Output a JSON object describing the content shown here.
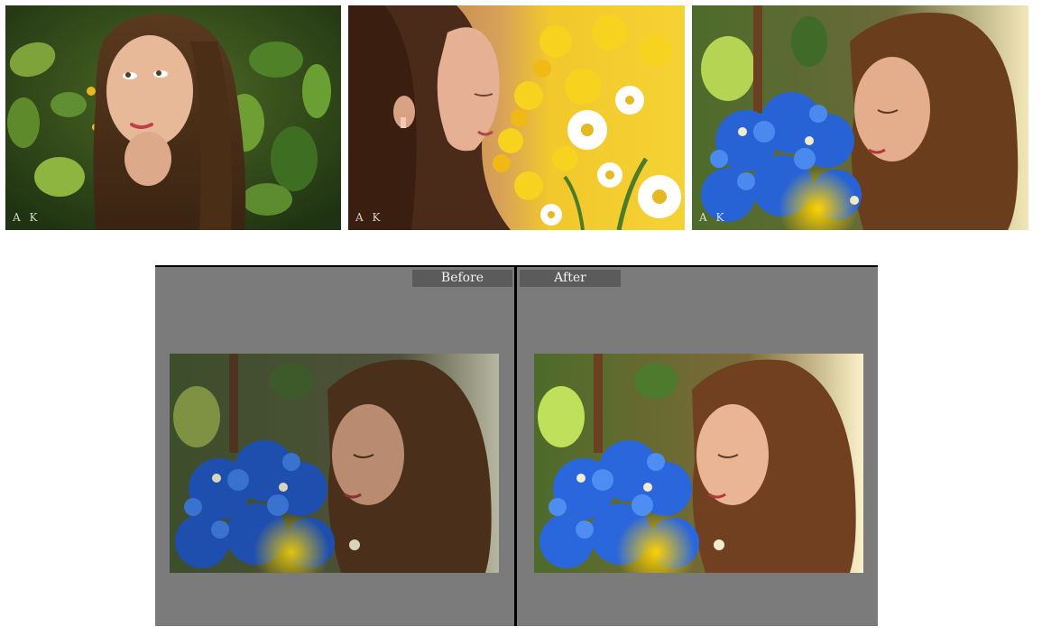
{
  "thumbnails": [
    {
      "name": "portrait-green-leaves",
      "watermark": "A K"
    },
    {
      "name": "portrait-yellow-daisies",
      "watermark": "A K"
    },
    {
      "name": "portrait-blue-hydrangea",
      "watermark": "A K"
    }
  ],
  "compare": {
    "before_label": "Before",
    "after_label": "After"
  },
  "colors": {
    "panel_bg": "#7b7b7b",
    "tag_bg": "#5b5b5b",
    "divider": "#000000"
  }
}
